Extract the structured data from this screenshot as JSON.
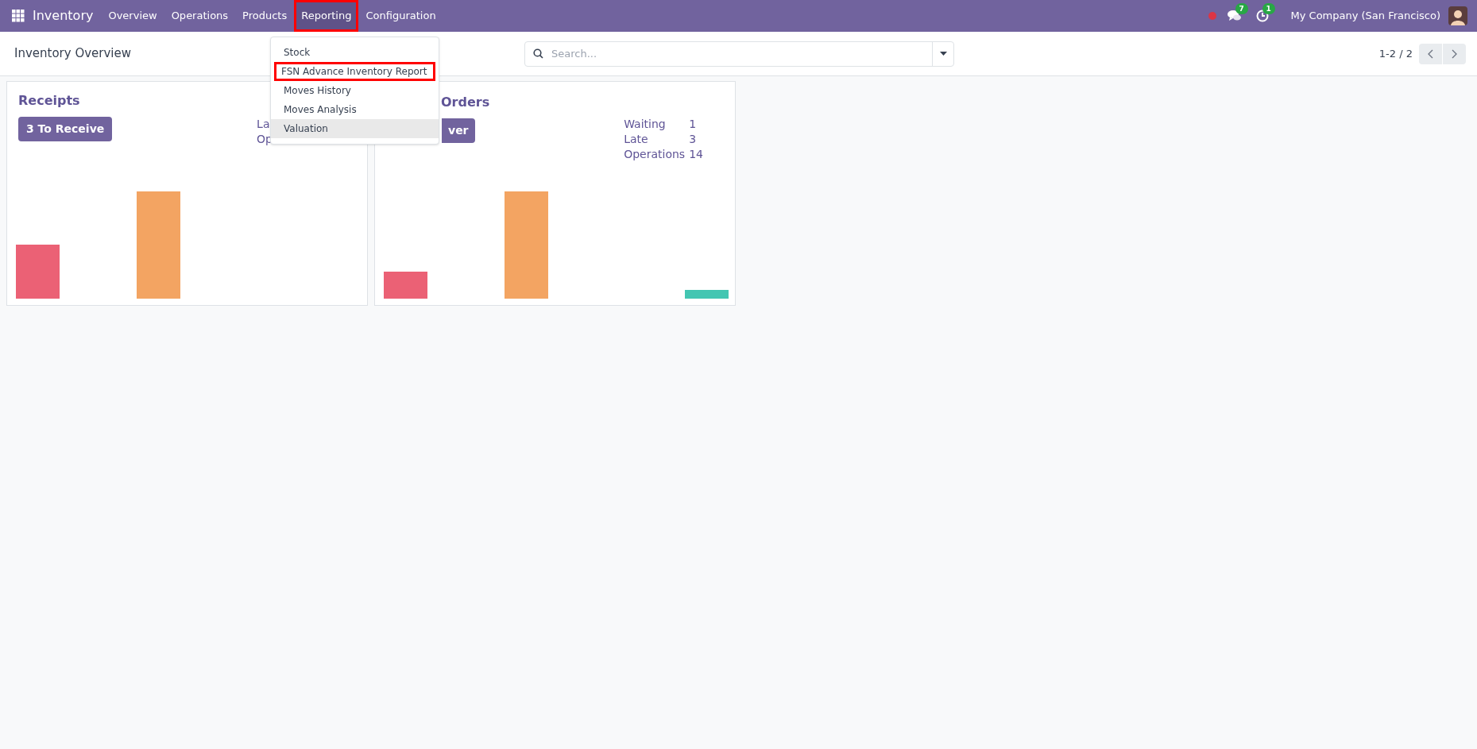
{
  "navbar": {
    "app_name": "Inventory",
    "menu": [
      {
        "label": "Overview",
        "selected": false,
        "outlined": false
      },
      {
        "label": "Operations",
        "selected": false,
        "outlined": false
      },
      {
        "label": "Products",
        "selected": false,
        "outlined": false
      },
      {
        "label": "Reporting",
        "selected": true,
        "outlined": true
      },
      {
        "label": "Configuration",
        "selected": false,
        "outlined": false
      }
    ],
    "messages_badge": "7",
    "activities_badge": "1",
    "company": "My Company (San Francisco)"
  },
  "reporting_menu": [
    {
      "label": "Stock",
      "hovered": false,
      "outlined": false
    },
    {
      "label": "FSN Advance Inventory Report",
      "hovered": false,
      "outlined": true
    },
    {
      "label": "Moves History",
      "hovered": false,
      "outlined": false
    },
    {
      "label": "Moves Analysis",
      "hovered": false,
      "outlined": false
    },
    {
      "label": "Valuation",
      "hovered": true,
      "outlined": false
    }
  ],
  "control_panel": {
    "title": "Inventory Overview",
    "search": {
      "placeholder": "Search..."
    },
    "pager": "1-2 / 2"
  },
  "cards": [
    {
      "title": "Receipts",
      "button": "3 To Receive",
      "stats": [
        {
          "label": "La"
        },
        {
          "label": "Op"
        }
      ]
    },
    {
      "title": "Orders",
      "button": "ver",
      "stats": [
        {
          "label": "Waiting",
          "value": "1"
        },
        {
          "label": "Late",
          "value": "3"
        },
        {
          "label": "Operations",
          "value": "14"
        }
      ]
    }
  ]
}
